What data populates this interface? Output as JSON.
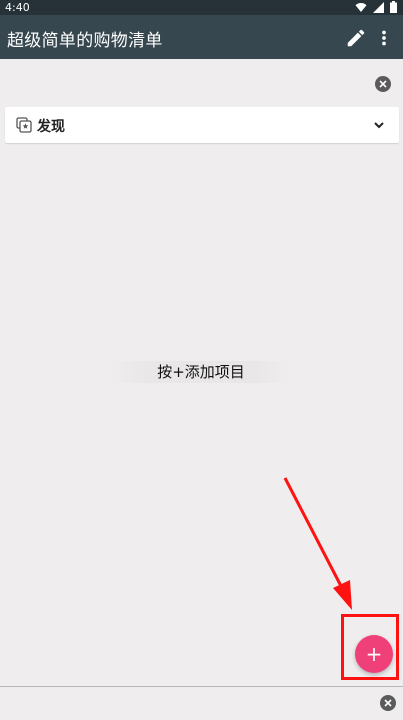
{
  "status_bar": {
    "time": "4:40"
  },
  "app_bar": {
    "title": "超级简单的购物清单"
  },
  "category": {
    "label": "发现"
  },
  "empty_state": {
    "message": "按+添加项目"
  },
  "fab": {
    "label": "+"
  },
  "colors": {
    "status_bar": "#263238",
    "app_bar": "#37474f",
    "background": "#efeded",
    "fab": "#f0407a",
    "highlight": "#ff1212"
  }
}
